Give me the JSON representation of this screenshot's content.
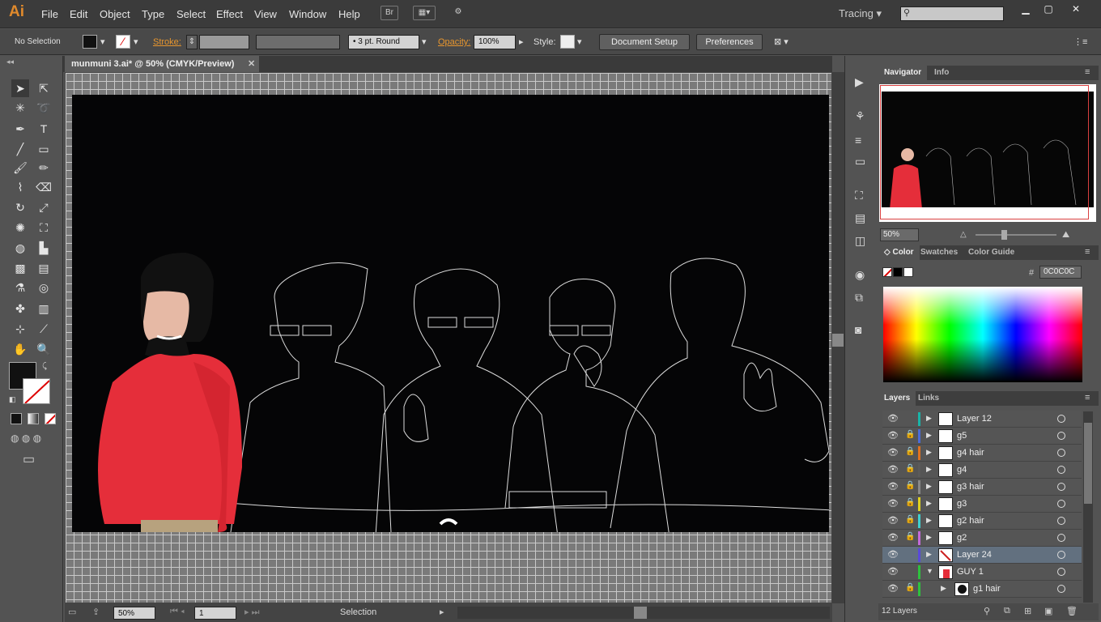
{
  "app": {
    "logo": "Ai",
    "menus": [
      "File",
      "Edit",
      "Object",
      "Type",
      "Select",
      "Effect",
      "View",
      "Window",
      "Help"
    ],
    "bridge": "Br",
    "workspace": "Tracing"
  },
  "control": {
    "selection": "No Selection",
    "stroke_label": "Stroke:",
    "brush": "3 pt. Round",
    "opacity_label": "Opacity:",
    "opacity_value": "100%",
    "style_label": "Style:",
    "doc_setup": "Document Setup",
    "preferences": "Preferences"
  },
  "document": {
    "tab_title": "munmuni 3.ai* @ 50% (CMYK/Preview)"
  },
  "status": {
    "zoom": "50%",
    "page": "1",
    "tool": "Selection"
  },
  "navigator": {
    "tabs": [
      "Navigator",
      "Info"
    ],
    "zoom": "50%"
  },
  "color": {
    "tabs": [
      "Color",
      "Swatches",
      "Color Guide"
    ],
    "hex_label": "#",
    "hex": "0C0C0C"
  },
  "layers": {
    "tabs": [
      "Layers",
      "Links"
    ],
    "count": "12 Layers",
    "rows": [
      {
        "name": "Layer 12",
        "color": "#19b4a8",
        "locked": false,
        "expanded": false,
        "thumb": "white"
      },
      {
        "name": "g5",
        "color": "#4a6bd9",
        "locked": true,
        "expanded": false,
        "thumb": "white"
      },
      {
        "name": "g4 hair",
        "color": "#e0721f",
        "locked": true,
        "expanded": false,
        "thumb": "white"
      },
      {
        "name": "g4",
        "color": "#5a5a5a",
        "locked": true,
        "expanded": false,
        "thumb": "white"
      },
      {
        "name": "g3 hair",
        "color": "#888888",
        "locked": true,
        "expanded": false,
        "thumb": "white"
      },
      {
        "name": "g3",
        "color": "#e0d21f",
        "locked": true,
        "expanded": false,
        "thumb": "white"
      },
      {
        "name": "g2 hair",
        "color": "#3fd0d0",
        "locked": true,
        "expanded": false,
        "thumb": "white"
      },
      {
        "name": "g2",
        "color": "#c46ad9",
        "locked": true,
        "expanded": false,
        "thumb": "white"
      },
      {
        "name": "Layer 24",
        "color": "#5a4ad9",
        "locked": false,
        "expanded": false,
        "thumb": "figure",
        "selected": true
      },
      {
        "name": "GUY 1",
        "color": "#2ec23e",
        "locked": false,
        "expanded": true,
        "thumb": "red"
      },
      {
        "name": "g1 hair",
        "color": "#2ec23e",
        "locked": true,
        "expanded": false,
        "thumb": "hair",
        "sub": true
      }
    ]
  }
}
